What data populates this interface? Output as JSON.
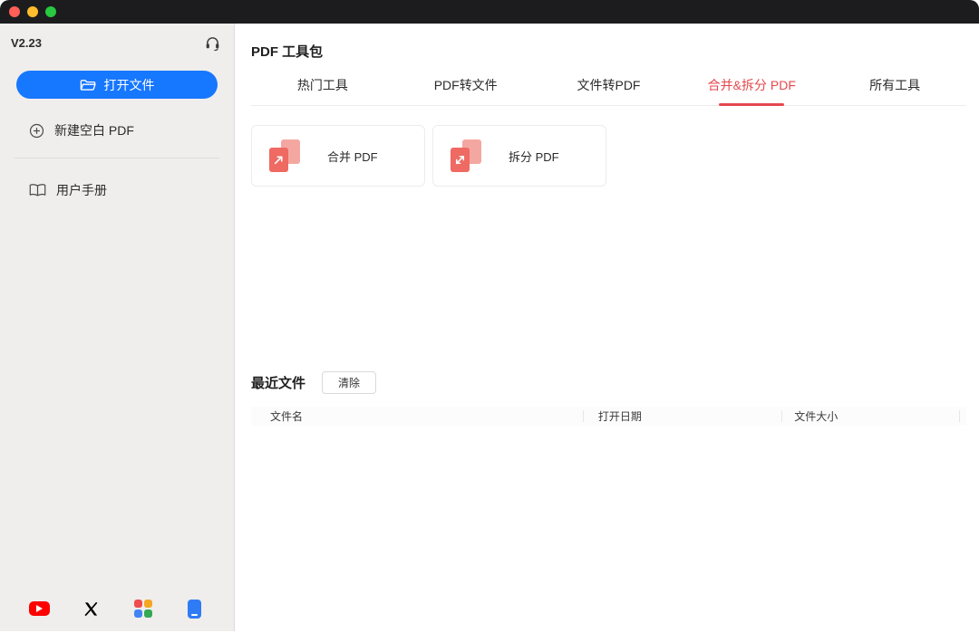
{
  "titlebar": {
    "buttons": [
      "close",
      "minimize",
      "zoom"
    ]
  },
  "sidebar": {
    "version": "V2.23",
    "open_file_label": "打开文件",
    "new_blank_pdf_label": "新建空白 PDF",
    "user_manual_label": "用户手册",
    "support_icon": "headset-icon",
    "social_icons": [
      "youtube-icon",
      "x-icon",
      "apps-grid-icon",
      "mobile-app-icon"
    ]
  },
  "main": {
    "title": "PDF 工具包",
    "tabs": [
      {
        "label": "热门工具",
        "active": false
      },
      {
        "label": "PDF转文件",
        "active": false
      },
      {
        "label": "文件转PDF",
        "active": false
      },
      {
        "label": "合并&拆分 PDF",
        "active": true
      },
      {
        "label": "所有工具",
        "active": false
      }
    ],
    "tools": [
      {
        "label": "合并 PDF",
        "icon": "merge-pdf-icon"
      },
      {
        "label": "拆分 PDF",
        "icon": "split-pdf-icon"
      }
    ],
    "recent": {
      "title": "最近文件",
      "clear_button": "清除",
      "columns": [
        "文件名",
        "打开日期",
        "文件大小"
      ],
      "rows": []
    }
  },
  "colors": {
    "accent_blue": "#1677ff",
    "accent_red": "#e5484d",
    "tool_icon_light": "#f4a7a1",
    "tool_icon_dark": "#ee6a62",
    "titlebar_bg": "#1c1c1e",
    "sidebar_bg": "#efeeec"
  }
}
